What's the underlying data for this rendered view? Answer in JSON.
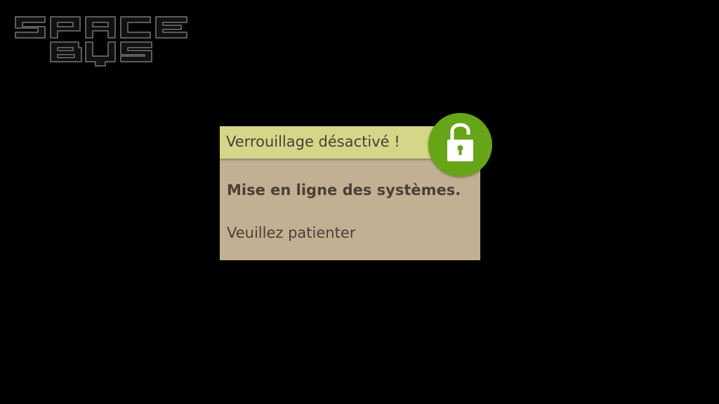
{
  "logo": {
    "line1": "SPACE",
    "line2": "BUS"
  },
  "dialog": {
    "title": "Verrouillage désactivé !",
    "message": "Mise en ligne des systèmes.",
    "subtext": "Veuillez patienter",
    "status_icon": "unlocked-padlock-icon"
  },
  "colors": {
    "background": "#000000",
    "dialog_body": "#c2b093",
    "dialog_header": "#d6d689",
    "text": "#4a4036",
    "badge": "#67a518",
    "logo_stroke": "#5a5a5a"
  }
}
